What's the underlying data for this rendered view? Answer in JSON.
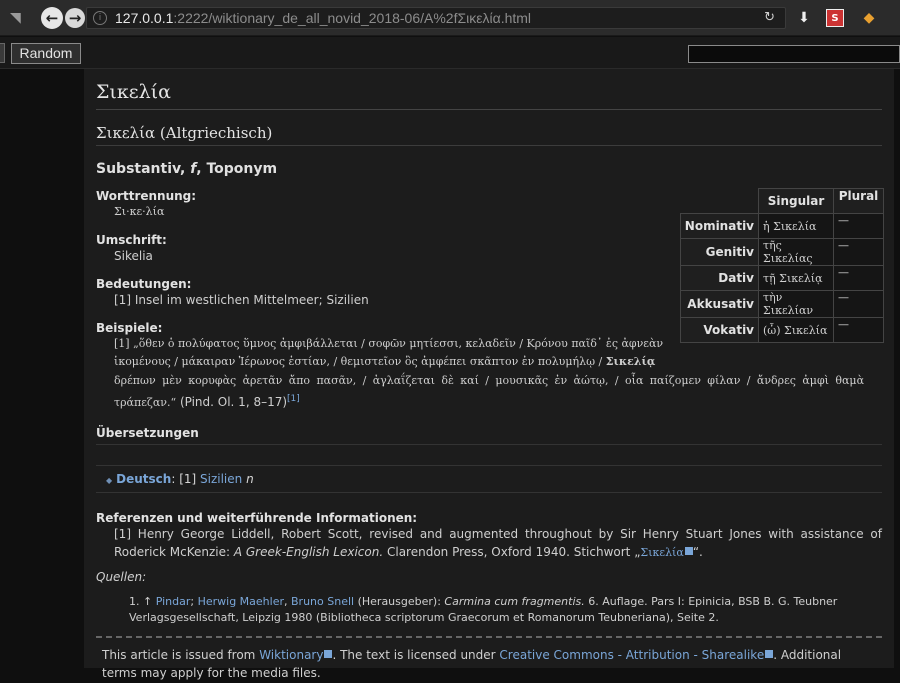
{
  "browser": {
    "url_host": "127.0.0.1",
    "url_path": ":2222/wiktionary_de_all_novid_2018-06/A%2fΣικελία.html"
  },
  "toolbar": {
    "random_label": "Random"
  },
  "article": {
    "title": "Σικελία",
    "lang_heading": "Σικελία (Altgriechisch)",
    "pos_main": "Substantiv, ",
    "pos_gender": "f",
    "pos_rest": ", Toponym",
    "worttrennung_label": "Worttrennung:",
    "worttrennung_value": "Σι·κε·λία",
    "umschrift_label": "Umschrift:",
    "umschrift_value": "Sikelia",
    "bedeutungen_label": "Bedeutungen:",
    "bedeutungen_value": "[1] Insel im westlichen Mittelmeer; Sizilien",
    "beispiele_label": "Beispiele:",
    "beispiel_line1": "[1] „ὅθεν ὁ πολύφατος ὕμνος ἀμφιβάλλεται / σοφῶν μητίεσσι, κελαδεῖν / Κρόνου παῖδ᾽ ἐς ἀφνεὰν",
    "beispiel_line2_a": "ἱκομένους / μάκαιραν Ἱέρωνος ἑστίαν, / θεμιστεῖον ὃς ἀμφέπει σκᾶπτον ἐν πολυμήλῳ / ",
    "beispiel_line2_bold": "Σικελίᾳ",
    "beispiel_line3": "δρέπων μὲν κορυφὰς ἀρετᾶν ἄπο πασᾶν, / ἀγλαΐζεται δὲ καί / μουσικᾶς ἐν ἀώτῳ, / οἷα παίζομεν φίλαν / ἄνδρες ἀμφὶ θαμὰ τράπεζαν.“",
    "beispiel_citation": "(Pind. Ol. 1, 8–17)",
    "beispiel_sup": "[1]",
    "uebersetzungen_label": "Übersetzungen",
    "translation_lang": "Deutsch",
    "translation_sense": ": [1] ",
    "translation_word": "Sizilien",
    "translation_gender": "n",
    "referenzen_label": "Referenzen und weiterführende Informationen:",
    "ref_text_a": "[1] Henry George Liddell, Robert Scott, revised and augmented throughout by Sir Henry Stuart Jones with assistance of Roderick McKenzie: ",
    "ref_text_italic": "A Greek-English Lexicon.",
    "ref_text_b": " Clarendon Press, Oxford 1940. Stichwort „",
    "ref_link": "Σικελία",
    "ref_text_c": "“.",
    "quellen_label": "Quellen:",
    "source_num": "1. ↑ ",
    "source_author1": "Pindar",
    "source_sep1": "; ",
    "source_author2": "Herwig Maehler",
    "source_sep2": ", ",
    "source_author3": "Bruno Snell",
    "source_editor": " (Herausgeber): ",
    "source_title": "Carmina cum fragmentis.",
    "source_rest": " 6. Auflage. Pars I: Epinicia, BSB B. G. Teubner Verlagsgesellschaft, Leipzig 1980 (Bibliotheca scriptorum Graecorum et Romanorum Teubneriana), Seite 2."
  },
  "inflection": {
    "col_singular": "Singular",
    "col_plural": "Plural",
    "rows": [
      {
        "case": "Nominativ",
        "singular": "ἡ Σικελία",
        "plural": "—"
      },
      {
        "case": "Genitiv",
        "singular": "τῆς Σικελίας",
        "plural": "—"
      },
      {
        "case": "Dativ",
        "singular": "τῇ Σικελίᾳ",
        "plural": "—"
      },
      {
        "case": "Akkusativ",
        "singular": "τὴν Σικελίαν",
        "plural": "—"
      },
      {
        "case": "Vokativ",
        "singular": "(ὦ) Σικελία",
        "plural": "—"
      }
    ]
  },
  "footer": {
    "text_a": "This article is issued from ",
    "link_wiktionary": "Wiktionary",
    "text_b": ". The text is licensed under ",
    "link_license": "Creative Commons - Attribution - Sharealike",
    "text_c": ". Additional terms may apply for the media files."
  },
  "colors": {
    "background": "#0f0f0f",
    "content_bg": "#1c1c1c",
    "link": "#7aa6d8"
  }
}
